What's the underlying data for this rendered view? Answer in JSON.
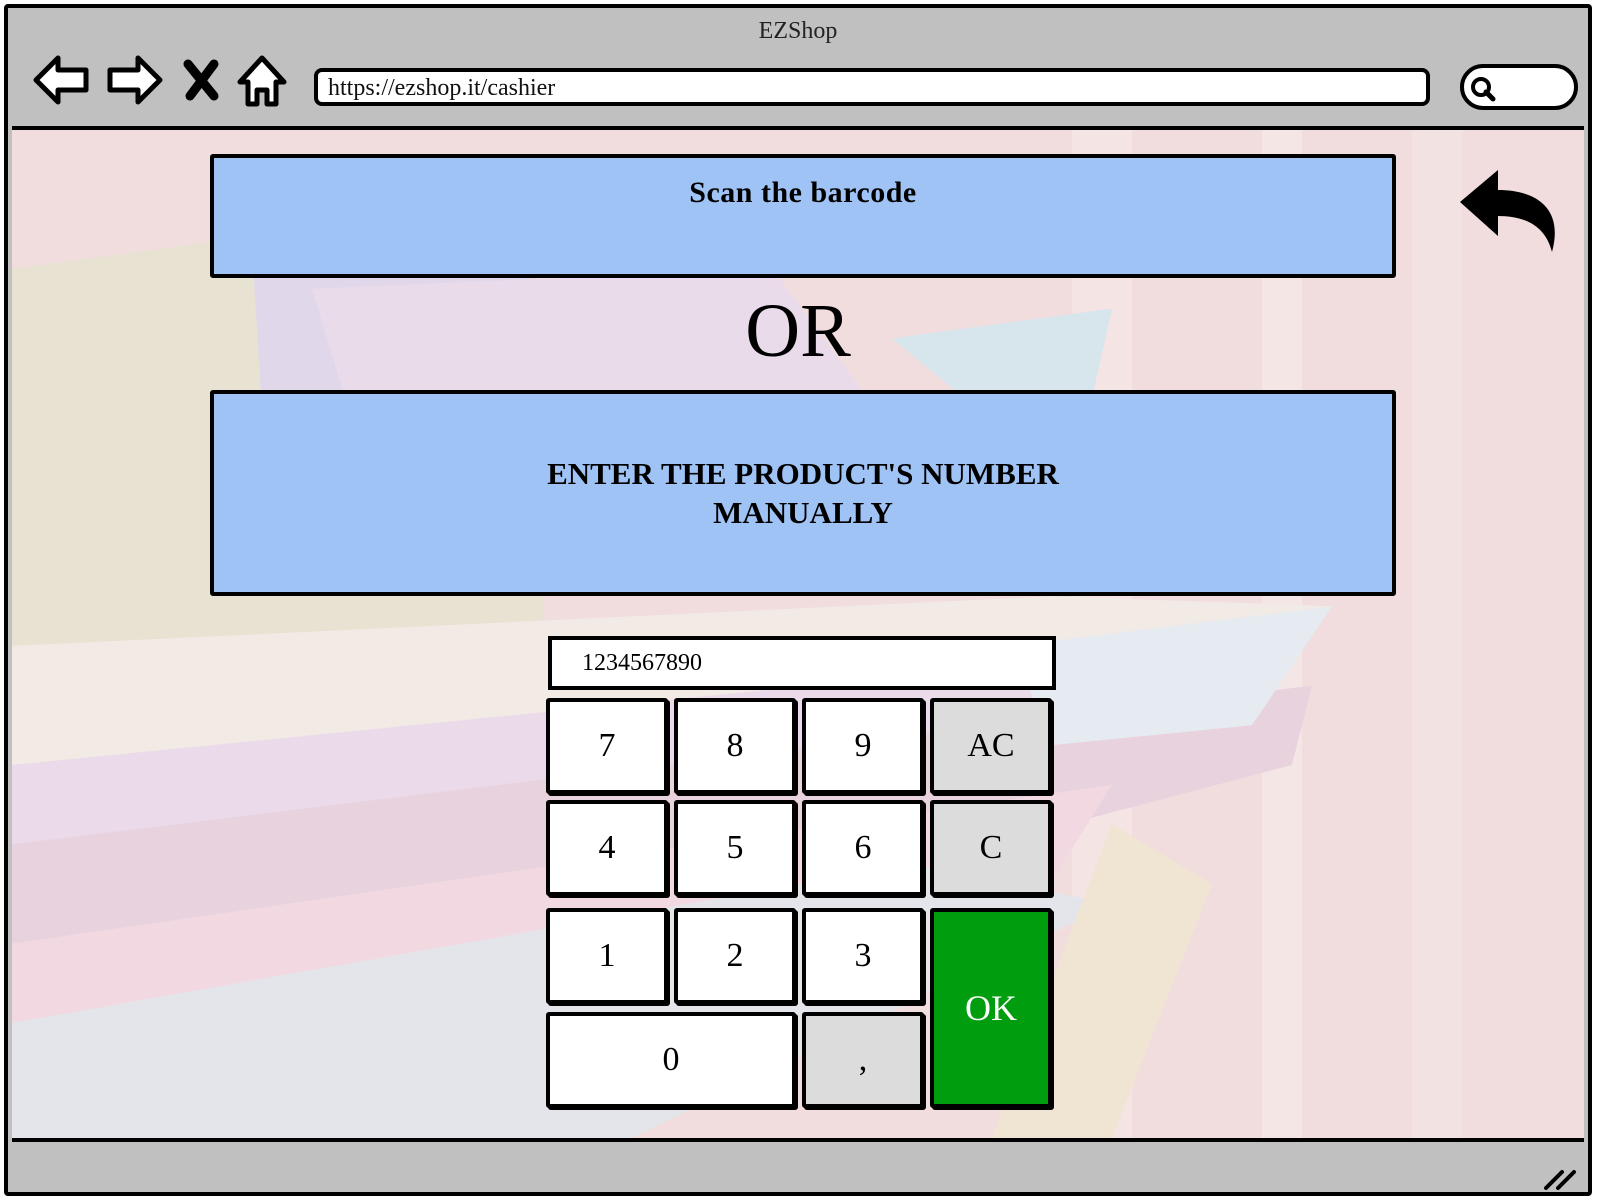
{
  "window": {
    "title": "EZShop"
  },
  "toolbar": {
    "back_icon": "back-arrow-icon",
    "forward_icon": "forward-arrow-icon",
    "stop_icon": "close-icon",
    "home_icon": "home-icon",
    "url": "https://ezshop.it/cashier",
    "search_icon": "search-icon"
  },
  "main": {
    "scan_label": "Scan the barcode",
    "or_label": "OR",
    "manual_label": "ENTER THE PRODUCT'S NUMBER MANUALLY",
    "undo_icon": "undo-arrow-icon"
  },
  "keypad": {
    "display_value": "1234567890",
    "keys": {
      "k7": "7",
      "k8": "8",
      "k9": "9",
      "ac": "AC",
      "k4": "4",
      "k5": "5",
      "k6": "6",
      "c": "C",
      "k1": "1",
      "k2": "2",
      "k3": "3",
      "ok": "OK",
      "k0": "0",
      "comma": ","
    }
  },
  "colors": {
    "chrome": "#c0c0c0",
    "panel": "#a0c3f5",
    "ok": "#009e0f",
    "function_key": "#dcdcdc"
  }
}
